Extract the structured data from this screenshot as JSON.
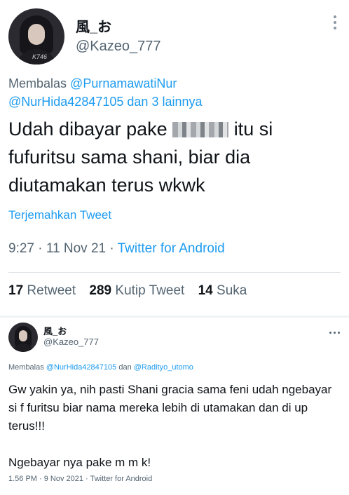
{
  "main_tweet": {
    "display_name": "風_お",
    "handle": "@Kazeo_777",
    "avatar_watermark": "K746",
    "replying_to_label": "Membalas",
    "reply_to_1": "@PurnamawatiNur",
    "reply_to_2": "@NurHida42847105",
    "reply_to_suffix": "dan 3 lainnya",
    "text_before_blur": "Udah dibayar pake",
    "text_after_blur": "itu si fufuritsu sama shani, biar dia diutamakan terus wkwk",
    "translate_label": "Terjemahkan Tweet",
    "time": "9:27",
    "date": "11 Nov 21",
    "source": "Twitter for Android",
    "retweets_count": "17",
    "retweets_label": "Retweet",
    "quotes_count": "289",
    "quotes_label": "Kutip Tweet",
    "likes_count": "14",
    "likes_label": "Suka"
  },
  "quoted_tweet": {
    "display_name": "風_お",
    "handle": "@Kazeo_777",
    "replying_to_label": "Membalas",
    "reply_to_1": "@NurHida42847105",
    "reply_to_join": "dan",
    "reply_to_2": "@Radityo_utomo",
    "paragraph_1": "Gw yakin ya, nih pasti Shani gracia sama feni udah ngebayar si f  furitsu biar nama mereka lebih di utamakan dan di up terus!!!",
    "paragraph_2": "Ngebayar nya pake m  m  k!",
    "timestamp": "1.56 PM · 9 Nov 2021 · Twitter for Android"
  },
  "colors": {
    "link": "#1d9bf0",
    "muted": "#536471",
    "text": "#0f1419",
    "divider": "#dfe3e6"
  },
  "icons": [
    "more-vertical-icon",
    "more-horizontal-icon"
  ]
}
